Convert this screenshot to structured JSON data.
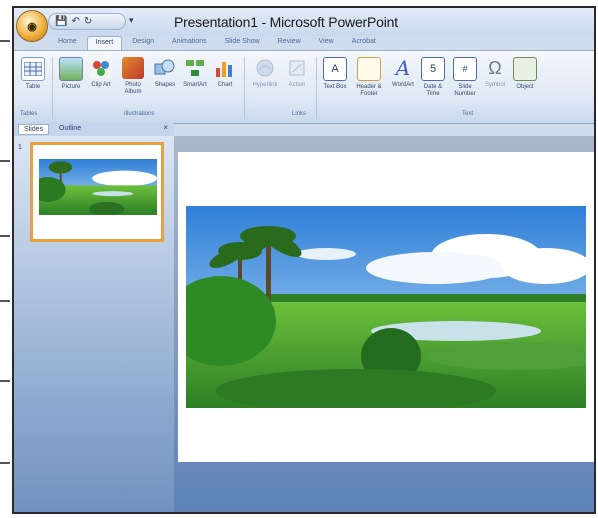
{
  "window": {
    "title": "Presentation1 - Microsoft PowerPoint",
    "office_button": "◉"
  },
  "quick_access": {
    "save_icon": "save-icon",
    "undo_icon": "undo-icon",
    "redo_icon": "redo-icon",
    "customize_icon": "chevron-down-icon"
  },
  "tabs": [
    {
      "label": "Home",
      "active": false
    },
    {
      "label": "Insert",
      "active": true
    },
    {
      "label": "Design",
      "active": false
    },
    {
      "label": "Animations",
      "active": false
    },
    {
      "label": "Slide Show",
      "active": false
    },
    {
      "label": "Review",
      "active": false
    },
    {
      "label": "View",
      "active": false
    },
    {
      "label": "Acrobat",
      "active": false
    }
  ],
  "ribbon": {
    "buttons": {
      "table": "Table",
      "picture": "Picture",
      "clip_art": "Clip Art",
      "photo_album": "Photo Album",
      "shapes": "Shapes",
      "smartart": "SmartArt",
      "chart": "Chart",
      "hyperlink": "Hyperlink",
      "action": "Action",
      "text_box": "Text Box",
      "header_footer": "Header & Footer",
      "wordart": "WordArt",
      "date_time": "Date & Time",
      "slide_number": "Slide Number",
      "symbol": "Symbol",
      "object": "Object"
    },
    "groups": {
      "tables": "Tables",
      "illustrations": "Illustrations",
      "links": "Links",
      "text": "Text"
    }
  },
  "slide_pane": {
    "tab_slides": "Slides",
    "tab_outline": "Outline",
    "close": "×",
    "slide_number": "1"
  },
  "colors": {
    "ribbon_bg": "#dde7f4",
    "selected_thumb_border": "#e8a040",
    "workspace": "#5e82b6"
  }
}
